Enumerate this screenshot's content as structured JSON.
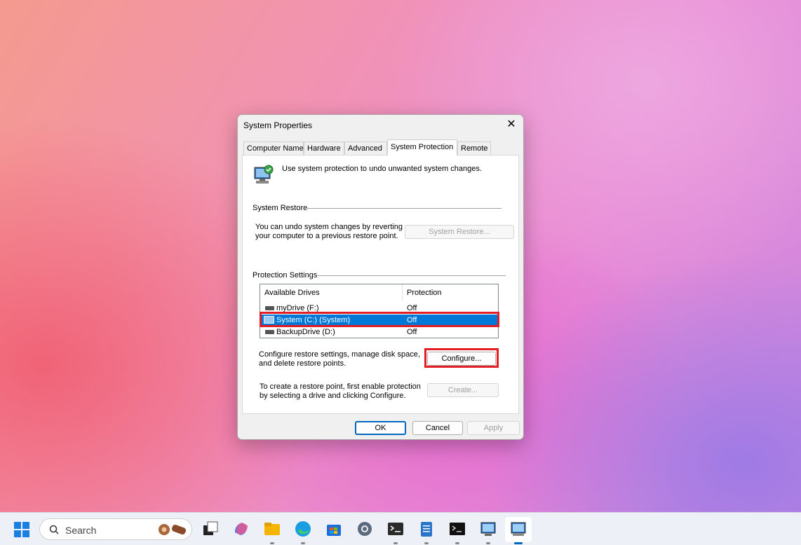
{
  "dialog": {
    "title": "System Properties",
    "close_glyph": "✕",
    "tabs": [
      {
        "label": "Computer Name"
      },
      {
        "label": "Hardware"
      },
      {
        "label": "Advanced"
      },
      {
        "label": "System Protection",
        "active": true
      },
      {
        "label": "Remote"
      }
    ],
    "intro_text": "Use system protection to undo unwanted system changes.",
    "system_restore": {
      "heading": "System Restore",
      "description_line1": "You can undo system changes by reverting",
      "description_line2": "your computer to a previous restore point.",
      "button_label": "System Restore..."
    },
    "protection_settings": {
      "heading": "Protection Settings",
      "columns": [
        "Available Drives",
        "Protection"
      ],
      "drives": [
        {
          "name": "myDrive (F:)",
          "protection": "Off"
        },
        {
          "name": "System (C:) (System)",
          "protection": "Off",
          "selected": true
        },
        {
          "name": "BackupDrive (D:)",
          "protection": "Off"
        }
      ],
      "configure_text_line1": "Configure restore settings, manage disk space,",
      "configure_text_line2": "and delete restore points.",
      "configure_button": "Configure...",
      "create_text_line1": "To create a restore point, first enable protection",
      "create_text_line2": "by selecting a drive and clicking Configure.",
      "create_button": "Create..."
    },
    "buttons": {
      "ok": "OK",
      "cancel": "Cancel",
      "apply": "Apply"
    }
  },
  "taskbar": {
    "search_label": "Search",
    "icons": [
      "start-icon",
      "task-view-icon",
      "copilot-icon",
      "file-explorer-icon",
      "edge-icon",
      "store-icon",
      "settings-icon",
      "terminal-icon",
      "notepad-icon",
      "command-prompt-icon",
      "control-panel-icon",
      "system-properties-icon"
    ]
  },
  "colors": {
    "selection": "#0078d7",
    "highlight": "#e41c24",
    "accent": "#0067c0"
  }
}
